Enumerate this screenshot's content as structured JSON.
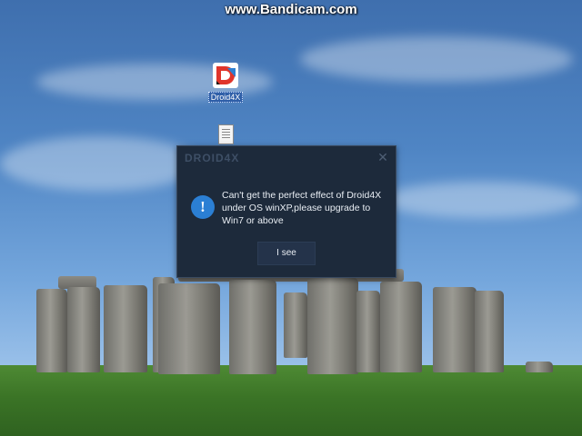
{
  "watermark": {
    "text": "www.Bandicam.com"
  },
  "desktop": {
    "icons": [
      {
        "label": "Droid4X",
        "icon": "droid4x-app-icon"
      },
      {
        "label": "",
        "icon": "text-document-icon"
      }
    ]
  },
  "dialog": {
    "logo": "DROID4X",
    "close_glyph": "✕",
    "icon": "info-icon",
    "icon_glyph": "!",
    "message": "Can't get the perfect effect of Droid4X under OS winXP,please upgrade to Win7 or above",
    "button_label": "I see"
  },
  "colors": {
    "dialog_bg": "#1d2a3b",
    "info_icon": "#2b7fd4",
    "button_bg": "#24334a",
    "droid_red": "#e0352b",
    "droid_blue": "#2e7fd1"
  }
}
